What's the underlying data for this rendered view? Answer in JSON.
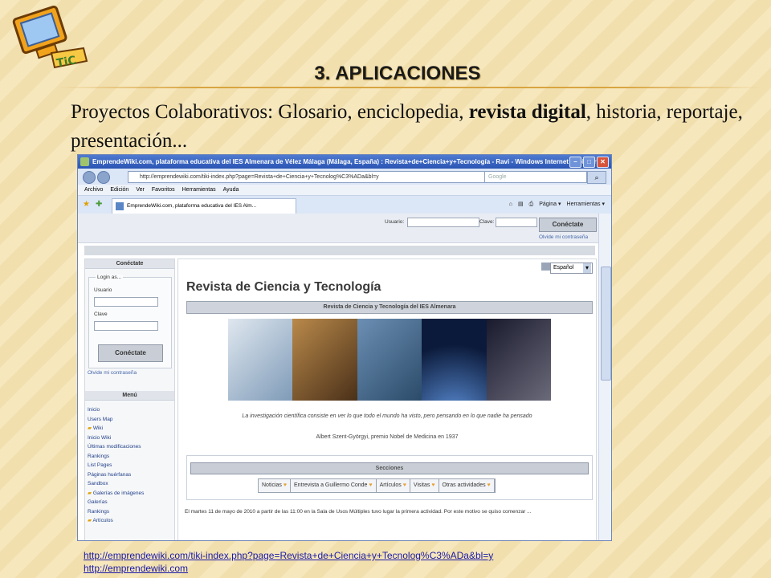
{
  "slide": {
    "title": "3. APLICACIONES",
    "body_prefix": "Proyectos Colaborativos:  Glosario, enciclopedia, ",
    "body_bold": "revista digital",
    "body_suffix": ", historia, reportaje, presentación...",
    "links": [
      "http://emprendewiki.com/tiki-index.php?page=Revista+de+Ciencia+y+Tecnolog%C3%ADa&bl=y",
      "http://emprendewiki.com"
    ]
  },
  "browser": {
    "window_title": "EmprendeWiki.com, plataforma educativa del IES Almenara de Vélez Málaga (Málaga, España) : Revista+de+Ciencia+y+Tecnología - Ravi - Windows Internet Explorer",
    "address": "http://emprendewiki.com/tiki-index.php?page=Revista+de+Ciencia+y+Tecnolog%C3%ADa&bl=y",
    "search_placeholder": "Google",
    "menu": [
      "Archivo",
      "Edición",
      "Ver",
      "Favoritos",
      "Herramientas",
      "Ayuda"
    ],
    "tab_label": "EmprendeWiki.com, plataforma educativa del IES Alm...",
    "commands": [
      "Página ▾",
      "Herramientas ▾"
    ]
  },
  "site": {
    "user_label": "Usuario:",
    "password_label": "Clave:",
    "connect_button": "Conéctate",
    "forgot_top": "Olvide mi contraseña",
    "sidebar_login_header": "Conéctate",
    "login_as": "Login as...",
    "side_user": "Usuario",
    "side_password": "Clave",
    "side_connect": "Conéctate",
    "side_forgot": "Olvide mi contraseña",
    "menu_header": "Menú",
    "menu_items": [
      "Inicio",
      "Users Map",
      "Wiki",
      "Inicio Wiki",
      "Últimas modificaciones",
      "Rankings",
      "List Pages",
      "Páginas huérfanas",
      "Sandbox",
      "Galerías de imágenes",
      "Galerías",
      "Rankings",
      "Artículos"
    ],
    "language": "Español",
    "page_title": "Revista de Ciencia y Tecnología",
    "band_title": "Revista de Ciencia y Tecnología del IES Almenara",
    "quote": "La investigación científica consiste en ver lo que todo el mundo ha visto, pero pensando en lo que nadie ha pensado",
    "quote_author": "Albert Szent-Györgyi, premio Nobel de Medicina en 1937",
    "sections_header": "Secciones",
    "sections": [
      "Noticias",
      "Entrevista a Guillermo Conde",
      "Artículos",
      "Visitas",
      "Otras actividades"
    ],
    "paragraph": "El martes 11 de mayo de 2010 a partir de las 11:00 en la Sala de Usos Múltiples tuvo lugar la primera actividad. Por este motivo se quiso comenzar ..."
  }
}
